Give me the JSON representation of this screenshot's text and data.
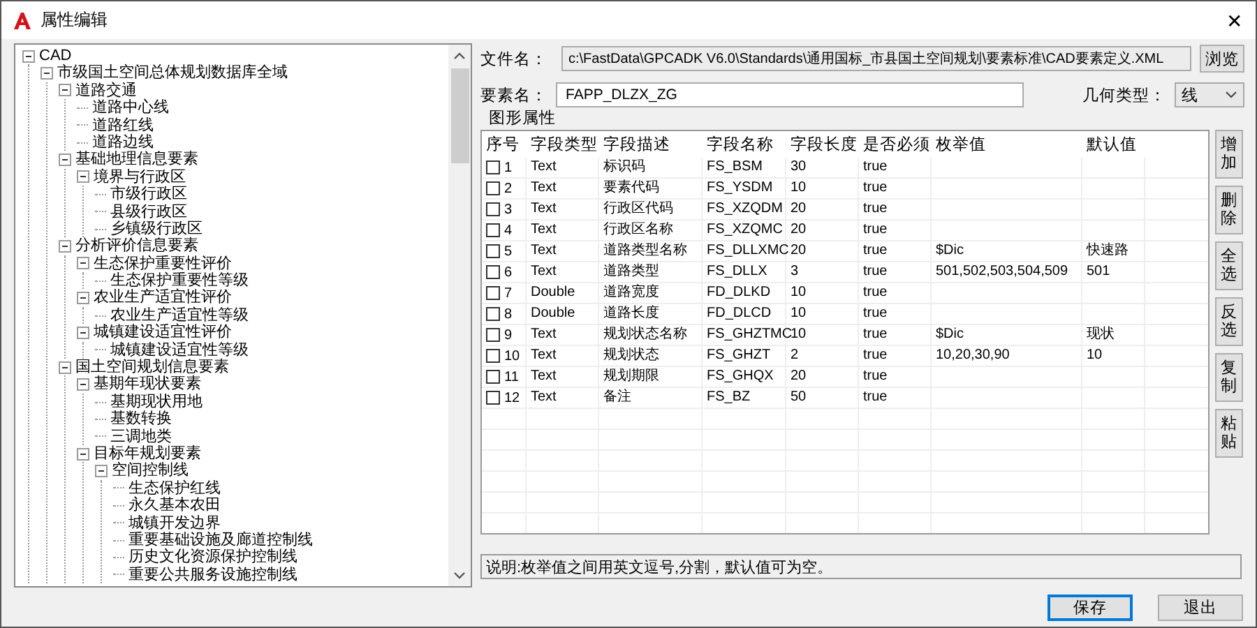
{
  "window": {
    "title": "属性编辑",
    "close": "✕"
  },
  "tree": [
    {
      "label": "CAD",
      "expanded": true,
      "children": [
        {
          "label": "市级国土空间总体规划数据库全域",
          "expanded": true,
          "children": [
            {
              "label": "道路交通",
              "expanded": true,
              "children": [
                {
                  "label": "道路中心线"
                },
                {
                  "label": "道路红线"
                },
                {
                  "label": "道路边线"
                }
              ]
            },
            {
              "label": "基础地理信息要素",
              "expanded": true,
              "children": [
                {
                  "label": "境界与行政区",
                  "expanded": true,
                  "children": [
                    {
                      "label": "市级行政区"
                    },
                    {
                      "label": "县级行政区"
                    },
                    {
                      "label": "乡镇级行政区"
                    }
                  ]
                }
              ]
            },
            {
              "label": "分析评价信息要素",
              "expanded": true,
              "children": [
                {
                  "label": "生态保护重要性评价",
                  "expanded": true,
                  "children": [
                    {
                      "label": "生态保护重要性等级"
                    }
                  ]
                },
                {
                  "label": "农业生产适宜性评价",
                  "expanded": true,
                  "children": [
                    {
                      "label": "农业生产适宜性等级"
                    }
                  ]
                },
                {
                  "label": "城镇建设适宜性评价",
                  "expanded": true,
                  "children": [
                    {
                      "label": "城镇建设适宜性等级"
                    }
                  ]
                }
              ]
            },
            {
              "label": "国土空间规划信息要素",
              "expanded": true,
              "children": [
                {
                  "label": "基期年现状要素",
                  "expanded": true,
                  "children": [
                    {
                      "label": "基期现状用地"
                    },
                    {
                      "label": "基数转换"
                    },
                    {
                      "label": "三调地类"
                    }
                  ]
                },
                {
                  "label": "目标年规划要素",
                  "expanded": true,
                  "children": [
                    {
                      "label": "空间控制线",
                      "expanded": true,
                      "children": [
                        {
                          "label": "生态保护红线"
                        },
                        {
                          "label": "永久基本农田"
                        },
                        {
                          "label": "城镇开发边界"
                        },
                        {
                          "label": "重要基础设施及廊道控制线"
                        },
                        {
                          "label": "历史文化资源保护控制线"
                        },
                        {
                          "label": "重要公共服务设施控制线"
                        }
                      ]
                    }
                  ]
                }
              ]
            }
          ]
        }
      ]
    }
  ],
  "file": {
    "label": "文件名：",
    "value": "c:\\FastData\\GPCADK V6.0\\Standards\\通用国标_市县国土空间规划\\要素标准\\CAD要素定义.XML",
    "browse": "浏览"
  },
  "feature": {
    "label": "要素名：",
    "value": "FAPP_DLZX_ZG"
  },
  "geometry": {
    "label": "几何类型：",
    "value": "线"
  },
  "group_title": "图形属性",
  "table": {
    "columns": [
      "序号",
      "字段类型",
      "字段描述",
      "字段名称",
      "字段长度",
      "是否必须",
      "枚举值",
      "默认值"
    ],
    "rows": [
      {
        "checked": false,
        "cells": [
          "1",
          "Text",
          "标识码",
          "FS_BSM",
          "30",
          "true",
          "",
          ""
        ]
      },
      {
        "checked": false,
        "cells": [
          "2",
          "Text",
          "要素代码",
          "FS_YSDM",
          "10",
          "true",
          "",
          ""
        ]
      },
      {
        "checked": false,
        "cells": [
          "3",
          "Text",
          "行政区代码",
          "FS_XZQDM",
          "20",
          "true",
          "",
          ""
        ]
      },
      {
        "checked": false,
        "cells": [
          "4",
          "Text",
          "行政区名称",
          "FS_XZQMC",
          "20",
          "true",
          "",
          ""
        ]
      },
      {
        "checked": false,
        "cells": [
          "5",
          "Text",
          "道路类型名称",
          "FS_DLLXMC",
          "20",
          "true",
          "$Dic",
          "快速路"
        ]
      },
      {
        "checked": false,
        "cells": [
          "6",
          "Text",
          "道路类型",
          "FS_DLLX",
          "3",
          "true",
          "501,502,503,504,509",
          "501"
        ]
      },
      {
        "checked": false,
        "cells": [
          "7",
          "Double",
          "道路宽度",
          "FD_DLKD",
          "10",
          "true",
          "",
          ""
        ]
      },
      {
        "checked": false,
        "cells": [
          "8",
          "Double",
          "道路长度",
          "FD_DLCD",
          "10",
          "true",
          "",
          ""
        ]
      },
      {
        "checked": false,
        "cells": [
          "9",
          "Text",
          "规划状态名称",
          "FS_GHZTMC",
          "10",
          "true",
          "$Dic",
          "现状"
        ]
      },
      {
        "checked": false,
        "cells": [
          "10",
          "Text",
          "规划状态",
          "FS_GHZT",
          "2",
          "true",
          "10,20,30,90",
          "10"
        ]
      },
      {
        "checked": false,
        "cells": [
          "11",
          "Text",
          "规划期限",
          "FS_GHQX",
          "20",
          "true",
          "",
          ""
        ]
      },
      {
        "checked": false,
        "cells": [
          "12",
          "Text",
          "备注",
          "FS_BZ",
          "50",
          "true",
          "",
          ""
        ]
      }
    ]
  },
  "side_buttons": [
    "增加",
    "删除",
    "全选",
    "反选",
    "复制",
    "粘贴"
  ],
  "note": "说明:枚举值之间用英文逗号,分割，默认值可为空。",
  "buttons": [
    {
      "label": "保存",
      "default": true
    },
    {
      "label": "退出",
      "default": false
    }
  ]
}
